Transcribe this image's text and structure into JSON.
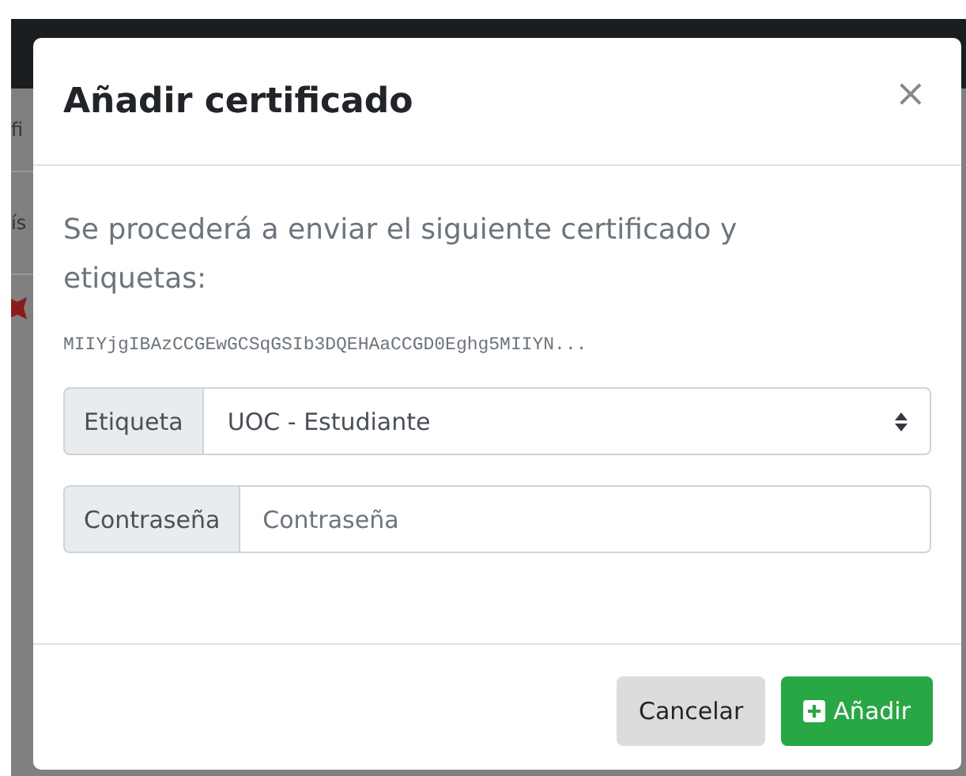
{
  "background": {
    "fragments": [
      {
        "text": "fi"
      },
      {
        "text": "ís"
      }
    ]
  },
  "dialog": {
    "title": "Añadir certificado",
    "close": "×",
    "message": "Se procederá a enviar el siguiente certificado y etiquetas:",
    "certificate": "MIIYjgIBAzCCGEwGCSqGSIb3DQEHAaCCGD0Eghg5MIIYN...",
    "fields": [
      {
        "kind": "select",
        "label": "Etiqueta",
        "value": "UOC - Estudiante"
      },
      {
        "kind": "password",
        "label": "Contraseña",
        "placeholder": "Contraseña"
      }
    ],
    "buttons": [
      {
        "kind": "secondary",
        "label": "Cancelar"
      },
      {
        "kind": "primary",
        "label": "Añadir"
      }
    ]
  }
}
